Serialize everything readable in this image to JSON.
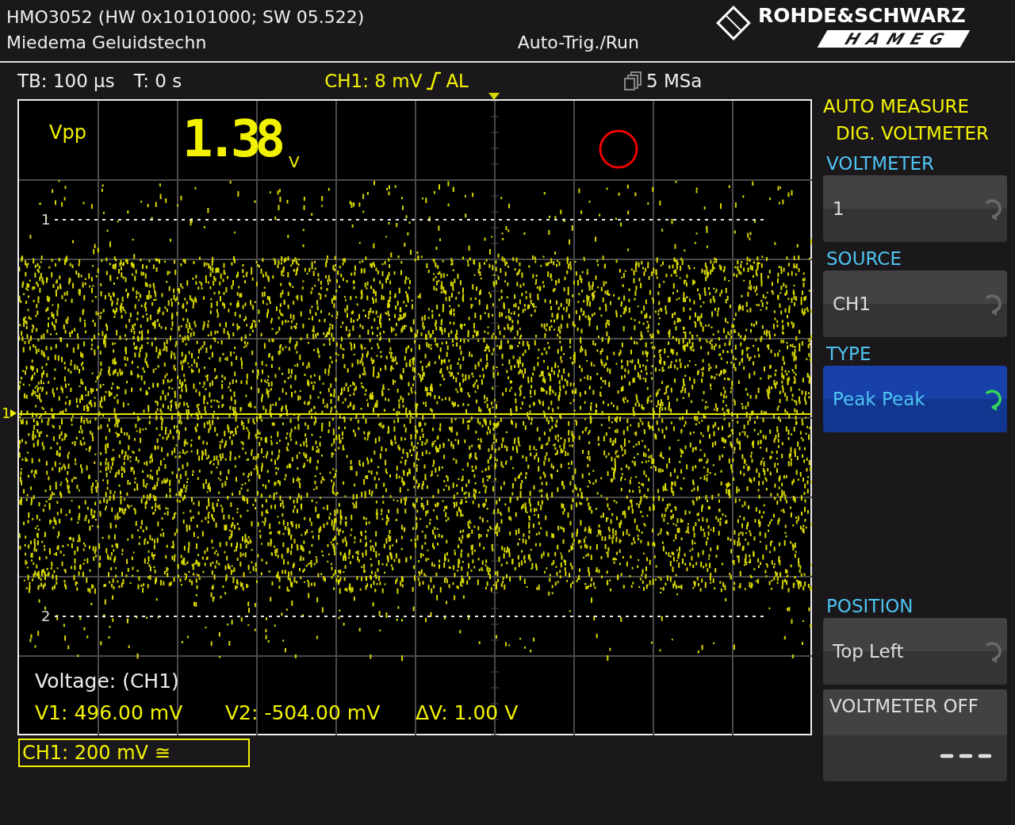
{
  "header": {
    "device": "HMO3052 (HW 0x10101000; SW 05.522)",
    "owner": "Miedema Geluidstechn",
    "status": "Auto-Trig./Run",
    "logo_top": "ROHDE&SCHWARZ",
    "logo_bottom": "HAMEG"
  },
  "info_bar": {
    "timebase": "TB: 100 µs",
    "trigger_time": "T: 0 s",
    "trigger_level": "CH1: 8 mV",
    "trigger_coupling": "AL",
    "sample_rate": "5 MSa"
  },
  "display": {
    "readout": {
      "label": "Vpp",
      "value": "1.38",
      "unit": "V"
    },
    "cursors": [
      {
        "label": "1"
      },
      {
        "label": "2"
      }
    ],
    "channel_marker": "1",
    "cursor_readout": {
      "title": "Voltage: (CH1)",
      "values": [
        "V1: 496.00 mV",
        "V2: -504.00 mV",
        "ΔV: 1.00 V"
      ]
    }
  },
  "channel_badge": "CH1: 200 mV ≅",
  "menu": {
    "title": "AUTO MEASURE",
    "subtitle": "DIG. VOLTMETER",
    "items": [
      {
        "kind": "selector",
        "label": "VOLTMETER",
        "value": "1",
        "selected": false
      },
      {
        "kind": "selector",
        "label": "SOURCE",
        "value": "CH1",
        "selected": false
      },
      {
        "kind": "selector",
        "label": "TYPE",
        "value": "Peak Peak",
        "selected": true
      }
    ],
    "bottom_items": [
      {
        "kind": "selector",
        "label": "POSITION",
        "value": "Top Left",
        "selected": false
      },
      {
        "kind": "toggle",
        "label": "VOLTMETER OFF"
      }
    ]
  }
}
